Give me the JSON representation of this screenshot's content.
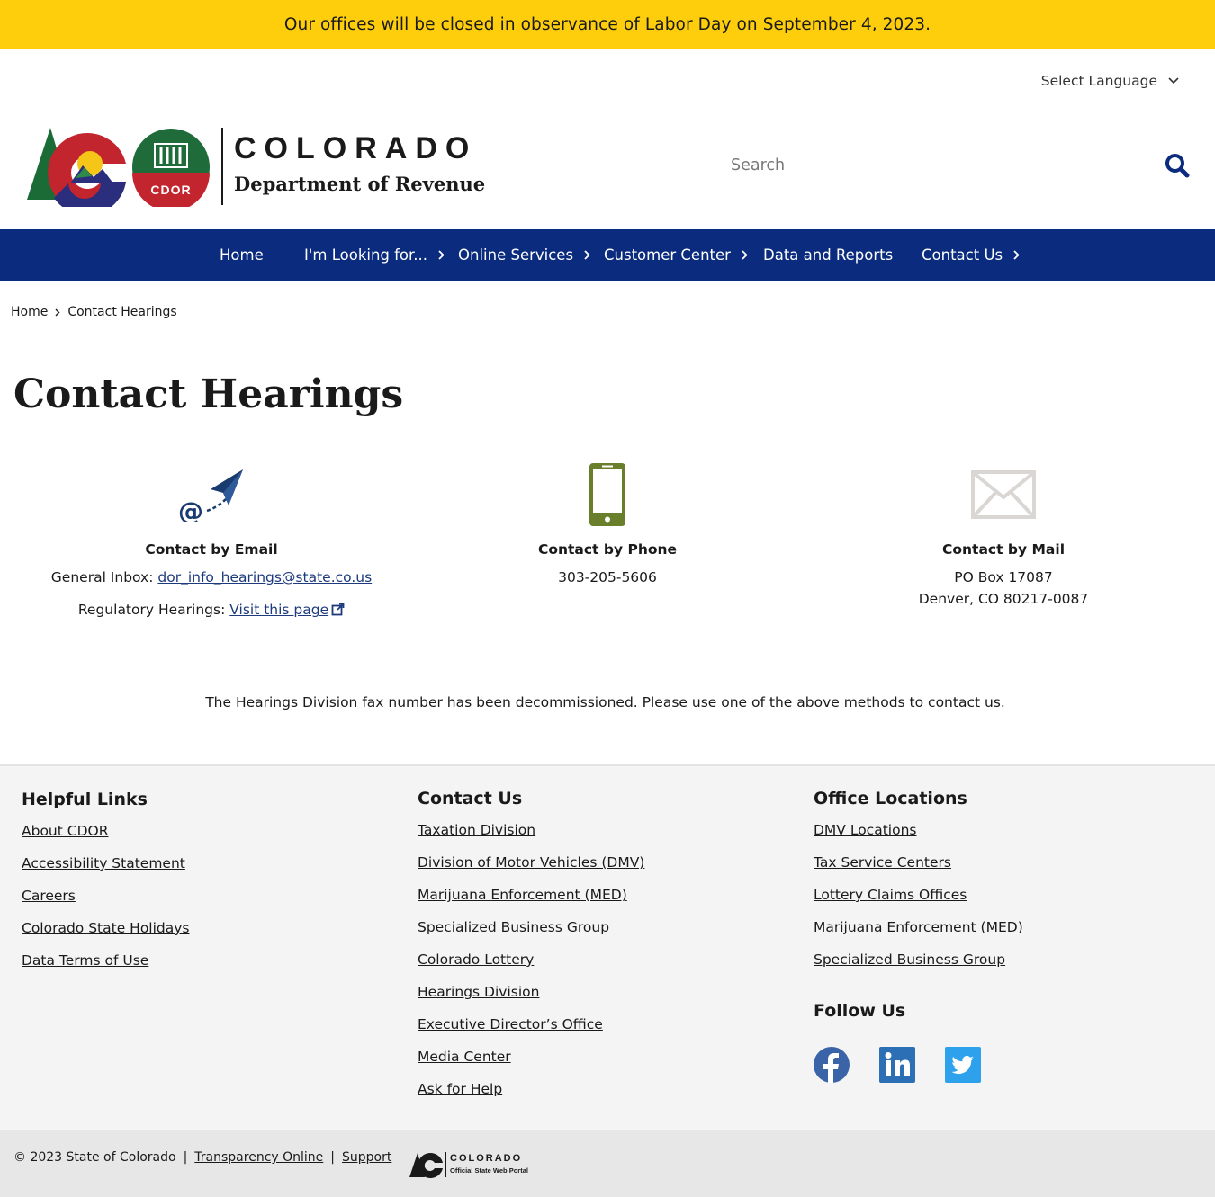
{
  "alert": {
    "text": "Our offices will be closed in observance of Labor Day on September 4, 2023."
  },
  "language": {
    "label": "Select Language"
  },
  "logo": {
    "line1": "COLORADO",
    "line2": "Department of Revenue",
    "seal_text": "CDOR"
  },
  "search": {
    "placeholder": "Search"
  },
  "nav": [
    {
      "label": "Home"
    },
    {
      "label": "I'm Looking for..."
    },
    {
      "label": "Online Services"
    },
    {
      "label": "Customer Center"
    },
    {
      "label": "Data and Reports"
    },
    {
      "label": "Contact Us"
    }
  ],
  "breadcrumb": {
    "home": "Home",
    "current": "Contact Hearings"
  },
  "page_title": "Contact Hearings",
  "contact": {
    "email": {
      "title": "Contact by Email",
      "inbox_label": "General Inbox:",
      "inbox_value": "dor_info_hearings@state.co.us",
      "reg_label": "Regulatory Hearings:",
      "reg_link": "Visit this page"
    },
    "phone": {
      "title": "Contact by Phone",
      "number": "303-205-5606"
    },
    "mail": {
      "title": "Contact by Mail",
      "line1": "PO Box 17087",
      "line2": "Denver, CO 80217-0087"
    }
  },
  "fax_note": "The Hearings Division fax number has been decommissioned. Please use one of the above methods to contact us.",
  "footer": {
    "helpful": {
      "title": "Helpful Links",
      "links": [
        "About CDOR",
        "Accessibility Statement",
        "Careers",
        "Colorado State Holidays",
        "Data Terms of Use"
      ]
    },
    "contact": {
      "title": "Contact Us",
      "links": [
        "Taxation Division",
        "Division of Motor Vehicles (DMV)",
        "Marijuana Enforcement (MED)",
        "Specialized Business Group",
        "Colorado Lottery",
        "Hearings Division",
        "Executive Director’s Office",
        "Media Center",
        "Ask for Help"
      ]
    },
    "offices": {
      "title": "Office Locations",
      "links": [
        "DMV Locations",
        "Tax Service Centers",
        "Lottery Claims Offices",
        "Marijuana Enforcement (MED)",
        "Specialized Business Group"
      ]
    },
    "follow": {
      "title": "Follow Us"
    }
  },
  "bottom": {
    "copyright": "© 2023 State of Colorado",
    "sep": "|",
    "transparency": "Transparency Online",
    "support": "Support",
    "portal_line1": "COLORADO",
    "portal_line2": "Official State Web Portal"
  },
  "colors": {
    "alert": "#fece0d",
    "nav": "#0b2b7e",
    "link": "#1d3a7c",
    "phone_icon": "#6a7f2c",
    "footer_bg": "#f4f4f4"
  }
}
